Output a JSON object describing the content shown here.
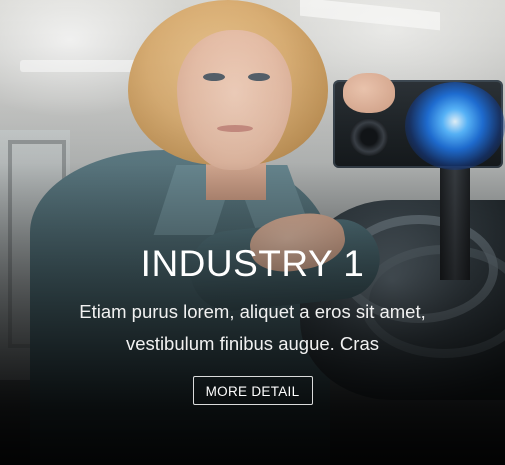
{
  "card": {
    "title": "INDUSTRY 1",
    "description": "Etiam purus lorem, aliquet a eros sit amet, vestibulum finibus augue. Cras",
    "button_label": "MORE DETAIL"
  },
  "colors": {
    "text": "#ffffff",
    "overlay": "#000000",
    "camera_glow": "#59b8ff"
  }
}
